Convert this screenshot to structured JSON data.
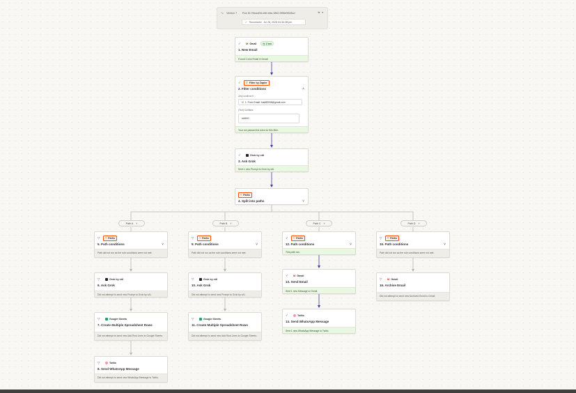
{
  "run": {
    "version": "Version 7",
    "run_id": "Run ID: f9eacd3d-efdf-efac-9840-3f98e0f048cd",
    "status": "Successful",
    "timestamp": "Jul 28, 2025 04:34:38 pm"
  },
  "steps": {
    "s1": {
      "app": "Gmail",
      "badge": "2 sec",
      "title": "1. New Email",
      "status": "Found 1 new Email in Gmail."
    },
    "s2": {
      "app": "Filter by Zapier",
      "title": "2. Filter conditions",
      "field_label": "Only continue if...",
      "field_value": "1. From Email: lna689098@gmail.com",
      "condition": "(Text) Contains",
      "condition_value": "tuMHG",
      "status": "Your run passed the rules for this filter."
    },
    "s3": {
      "app": "Grok by xAI",
      "title": "3. Ask Grok",
      "status": "Sent 1 new Prompt to Grok by xAI."
    },
    "s4": {
      "app": "Paths",
      "title": "4. Split into paths"
    }
  },
  "paths": [
    {
      "label": "Path A",
      "steps": [
        {
          "app": "Paths",
          "title": "5. Path conditions",
          "status": "Path did not run as the rule conditions were not met."
        },
        {
          "app": "Grok by xAI",
          "title": "6. Ask Grok",
          "status": "Did not attempt to send new Prompt to Grok by xAI."
        },
        {
          "app": "Google Sheets",
          "title": "7. Create Multiple Spreadsheet Rows",
          "status": "Did not attempt to send new Add Row Lines to Google Sheets."
        },
        {
          "app": "Twilio",
          "title": "8. Send WhatsApp Message",
          "status": "Did not attempt to send new WhatsApp Message to Twilio."
        }
      ]
    },
    {
      "label": "Path B",
      "steps": [
        {
          "app": "Paths",
          "title": "9. Path conditions",
          "status": "Path did not run as the rule conditions were not met."
        },
        {
          "app": "Grok by xAI",
          "title": "10. Ask Grok",
          "status": "Did not attempt to send new Prompt to Grok by xAI."
        },
        {
          "app": "Google Sheets",
          "title": "11. Create Multiple Spreadsheet Rows",
          "status": "Did not attempt to send new Add Row Lines to Google Sheets."
        }
      ]
    },
    {
      "label": "Path C",
      "steps": [
        {
          "app": "Paths",
          "title": "12. Path conditions",
          "status": "This path ran."
        },
        {
          "app": "Gmail",
          "title": "13. Send Email",
          "status": "Sent 1 new Message to Gmail."
        },
        {
          "app": "Twilio",
          "title": "14. Send WhatsApp Message",
          "status": "Sent 1 new WhatsApp Message to Twilio."
        }
      ]
    },
    {
      "label": "Path D",
      "steps": [
        {
          "app": "Paths",
          "title": "15. Path conditions",
          "status": "Path did not run as the rule conditions were not met."
        },
        {
          "app": "Gmail",
          "title": "16. Archive Email",
          "status": "Did not attempt to send new Archived Email to Gmail."
        }
      ]
    }
  ],
  "colors": {
    "accent": "#ff4f00",
    "success_bg": "#e8f8e1",
    "skipped_bg": "#efede8",
    "active_connector": "#3d3aa0",
    "inactive_connector": "#b8b5ae"
  },
  "icons": {
    "gmail": "gmail-icon",
    "filter": "filter-icon",
    "grok": "grok-icon",
    "paths": "paths-icon",
    "sheets": "google-sheets-icon",
    "twilio": "twilio-icon"
  }
}
